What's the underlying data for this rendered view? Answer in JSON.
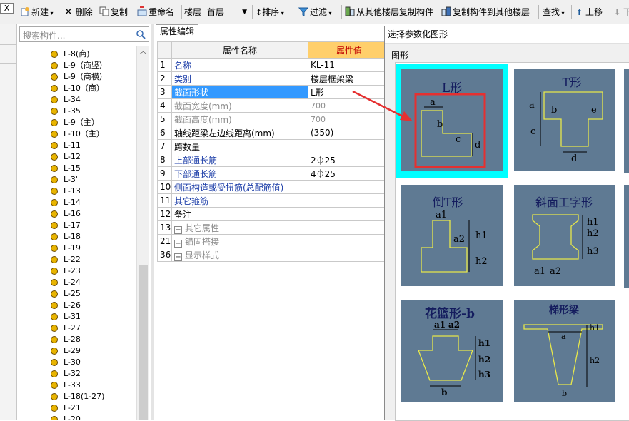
{
  "toolbar": {
    "close": "X",
    "new": "新建",
    "delete": "删除",
    "copy": "复制",
    "rename": "重命名",
    "floor_label": "楼层",
    "floor_value": "首层",
    "sort": "排序",
    "filter": "过滤",
    "copy_from_other": "从其他楼层复制构件",
    "copy_to_other": "复制构件到其他楼层",
    "find": "查找",
    "move_up": "上移",
    "move_down": "下"
  },
  "tree": {
    "search_placeholder": "搜索构件...",
    "items": [
      "L-8(商)",
      "L-9（商竖）",
      "L-9（商横）",
      "L-10（商）",
      "L-34",
      "L-35",
      "L-9（主）",
      "L-10（主）",
      "L-11",
      "L-12",
      "L-15",
      "L-3'",
      "L-13",
      "L-14",
      "L-16",
      "L-17",
      "L-18",
      "L-19",
      "L-22",
      "L-23",
      "L-24",
      "L-25",
      "L-26",
      "L-31",
      "L-27",
      "L-28",
      "L-29",
      "L-30",
      "L-32",
      "L-33",
      "L-18(1-27)",
      "L-21",
      "L-20"
    ]
  },
  "props": {
    "tab": "属性编辑",
    "col_name": "属性名称",
    "col_value": "属性值",
    "rows": [
      {
        "num": "1",
        "name": "名称",
        "value": "KL-11",
        "style": "blue"
      },
      {
        "num": "2",
        "name": "类别",
        "value": "楼层框架梁",
        "style": "blue"
      },
      {
        "num": "3",
        "name": "截面形状",
        "value": "L形",
        "style": "sel"
      },
      {
        "num": "4",
        "name": "截面宽度(mm)",
        "value": "700",
        "style": "gray"
      },
      {
        "num": "5",
        "name": "截面高度(mm)",
        "value": "700",
        "style": "gray"
      },
      {
        "num": "6",
        "name": "轴线距梁左边线距离(mm)",
        "value": "(350)",
        "style": "black"
      },
      {
        "num": "7",
        "name": "跨数量",
        "value": "",
        "style": "black"
      },
      {
        "num": "8",
        "name": "上部通长筋",
        "value": "2⏀25",
        "style": "blue"
      },
      {
        "num": "9",
        "name": "下部通长筋",
        "value": "4⏀25",
        "style": "blue"
      },
      {
        "num": "10",
        "name": "侧面构造或受扭筋(总配筋值)",
        "value": "",
        "style": "blue"
      },
      {
        "num": "11",
        "name": "其它箍筋",
        "value": "",
        "style": "blue"
      },
      {
        "num": "12",
        "name": "备注",
        "value": "",
        "style": "black"
      },
      {
        "num": "13",
        "name": "其它属性",
        "value": "",
        "style": "group"
      },
      {
        "num": "21",
        "name": "锚固搭接",
        "value": "",
        "style": "group"
      },
      {
        "num": "36",
        "name": "显示样式",
        "value": "",
        "style": "group"
      }
    ]
  },
  "dialog": {
    "title": "选择参数化图形",
    "group": "图形",
    "shapes": [
      {
        "name": "L形",
        "labels": {
          "a": "a",
          "b": "b",
          "c": "c",
          "d": "d"
        }
      },
      {
        "name": "T形",
        "labels": {
          "a": "a",
          "b": "b",
          "c": "c",
          "d": "d",
          "e": "e"
        }
      },
      {
        "name": "倒T形",
        "labels": {
          "a1": "a1",
          "a2": "a2",
          "h1": "h1",
          "h2": "h2"
        }
      },
      {
        "name": "斜面工字形",
        "labels": {
          "h1": "h1",
          "h2": "h2",
          "h3": "h3",
          "a1": "a1",
          "a2": "a2"
        }
      },
      {
        "name": "花篮形-b",
        "labels": {
          "a1": "a1",
          "a2": "a2",
          "h1": "h1",
          "h2": "h2",
          "h3": "h3",
          "b": "b"
        }
      },
      {
        "name": "梯形梁",
        "labels": {
          "a": "a",
          "h1": "h1",
          "h2": "h2",
          "b": "b"
        }
      }
    ]
  },
  "colors": {
    "selection": "#3399ff",
    "value_header_bg": "#ffcf6b",
    "value_header_text": "#c00000",
    "thumbnail_bg": "#5f7a93",
    "selected_cell": "#00ffff",
    "highlight_box": "#e53030",
    "shape_outline": "#e8e84a"
  }
}
